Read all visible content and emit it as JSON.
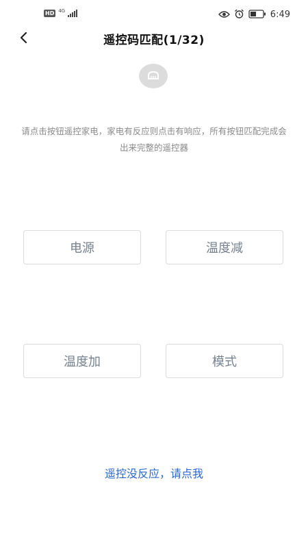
{
  "status_bar": {
    "hd": "HD",
    "network": "4G",
    "time": "6:49",
    "icons": [
      "eye-icon",
      "alarm-icon",
      "battery-icon"
    ]
  },
  "header": {
    "title": "遥控码匹配(1/32)"
  },
  "device": {
    "icon": "ac-unit-icon"
  },
  "instruction": "请点击按钮遥控家电，家电有反应则点击有响应，所有按钮匹配完成会出来完整的遥控器",
  "keys": [
    {
      "label": "电源"
    },
    {
      "label": "温度减"
    },
    {
      "label": "温度加"
    },
    {
      "label": "模式"
    }
  ],
  "footer": {
    "no_response_link": "遥控没反应，请点我"
  },
  "colors": {
    "key_text": "#778290",
    "link": "#2a67c9",
    "hint": "#8a8a8a"
  }
}
